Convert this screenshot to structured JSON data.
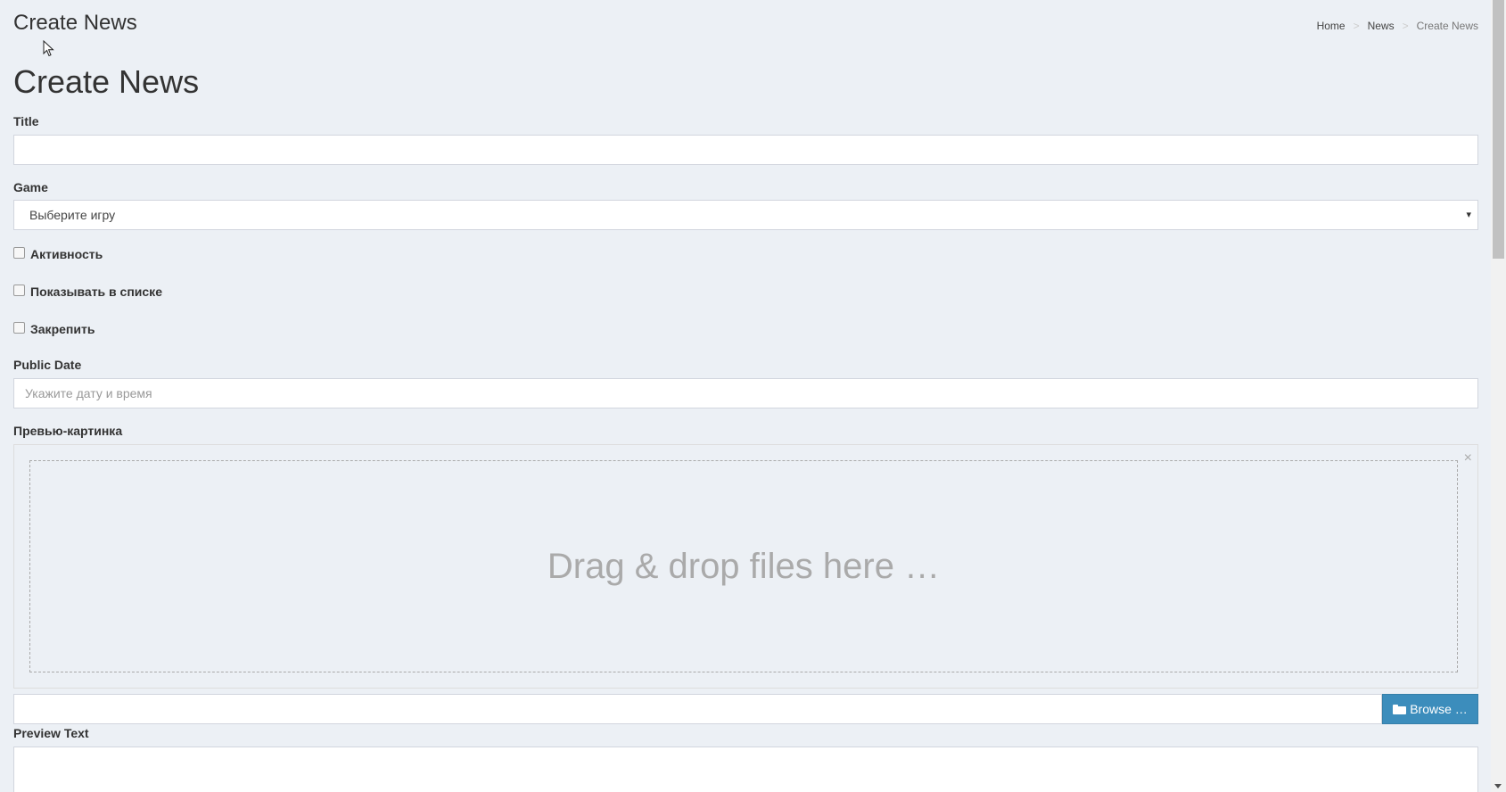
{
  "header": {
    "title": "Create News",
    "breadcrumb": {
      "home": "Home",
      "news": "News",
      "current": "Create News",
      "separator": ">"
    }
  },
  "form": {
    "heading": "Create News",
    "title_label": "Title",
    "title_value": "",
    "game_label": "Game",
    "game_selected": "Выберите игру",
    "checkboxes": [
      {
        "label": "Активность",
        "checked": false
      },
      {
        "label": "Показывать в списке",
        "checked": false
      },
      {
        "label": "Закрепить",
        "checked": false
      }
    ],
    "public_date_label": "Public Date",
    "public_date_placeholder": "Укажите дату и время",
    "preview_image_label": "Превью-картинка",
    "dropzone_text": "Drag & drop files here …",
    "close_symbol": "×",
    "browse_label": "Browse …",
    "preview_text_label": "Preview Text",
    "select_arrow": "▾"
  },
  "colors": {
    "background": "#ecf0f5",
    "primary": "#3c8dbc"
  }
}
